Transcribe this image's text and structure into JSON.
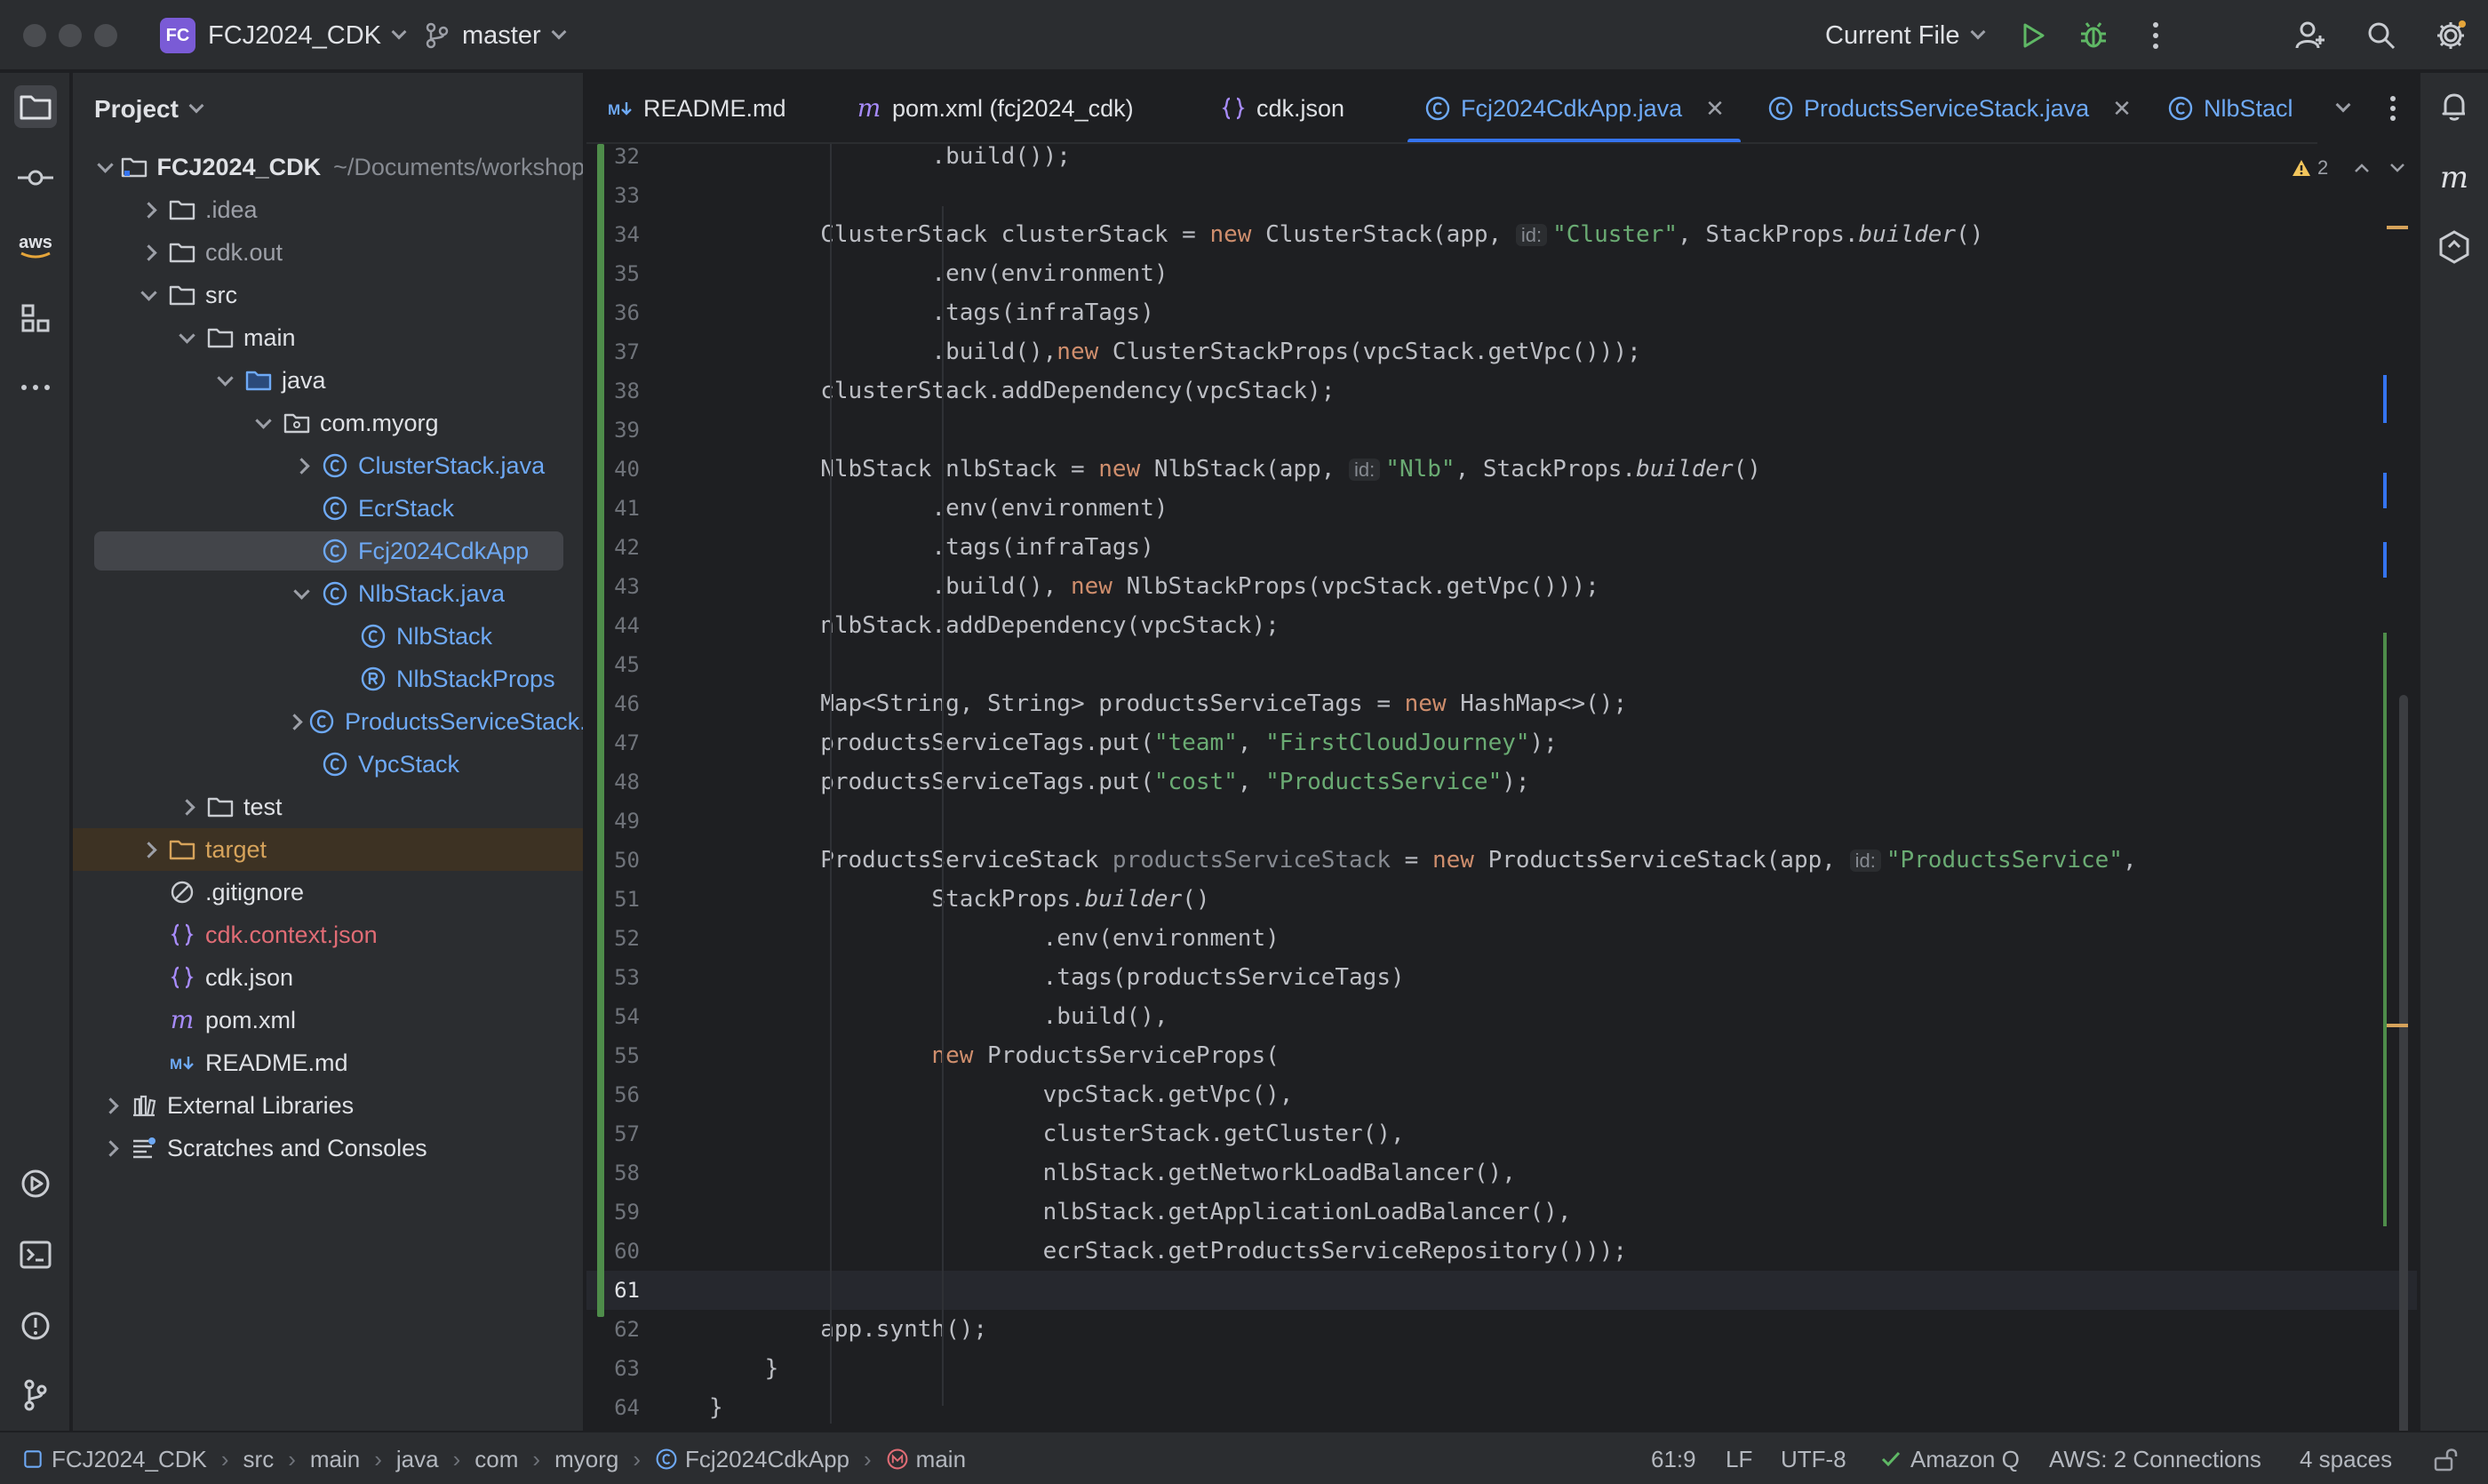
{
  "titlebar": {
    "project_badge": "FC",
    "project_name": "FCJ2024_CDK",
    "branch": "master",
    "run_config": "Current File"
  },
  "project_panel": {
    "title": "Project",
    "tree": [
      {
        "label": "FCJ2024_CDK",
        "hint": "~/Documents/workshop",
        "icon": "module-folder-icon",
        "expand": "down",
        "depth": 0,
        "color": "#dfe1e5",
        "bold": true
      },
      {
        "label": ".idea",
        "icon": "folder-icon",
        "expand": "right",
        "depth": 1,
        "color": "#9da0a8"
      },
      {
        "label": "cdk.out",
        "icon": "folder-icon",
        "expand": "right",
        "depth": 1,
        "color": "#9da0a8"
      },
      {
        "label": "src",
        "icon": "folder-icon",
        "expand": "down",
        "depth": 1,
        "color": "#dfe1e5"
      },
      {
        "label": "main",
        "icon": "folder-icon",
        "expand": "down",
        "depth": 2,
        "color": "#dfe1e5"
      },
      {
        "label": "java",
        "icon": "source-folder-icon",
        "expand": "down",
        "depth": 3,
        "color": "#dfe1e5"
      },
      {
        "label": "com.myorg",
        "icon": "package-icon",
        "expand": "down",
        "depth": 4,
        "color": "#dfe1e5"
      },
      {
        "label": "ClusterStack.java",
        "icon": "java-class-icon",
        "expand": "right",
        "depth": 5,
        "color": "#6ea9f5"
      },
      {
        "label": "EcrStack",
        "icon": "java-class-icon",
        "expand": "none",
        "depth": 5,
        "color": "#6ea9f5"
      },
      {
        "label": "Fcj2024CdkApp",
        "icon": "java-class-icon",
        "expand": "none",
        "depth": 5,
        "color": "#6ea9f5",
        "selected": true
      },
      {
        "label": "NlbStack.java",
        "icon": "java-class-icon",
        "expand": "down",
        "depth": 5,
        "color": "#6ea9f5"
      },
      {
        "label": "NlbStack",
        "icon": "java-class-icon",
        "expand": "none",
        "depth": 6,
        "color": "#6ea9f5"
      },
      {
        "label": "NlbStackProps",
        "icon": "java-record-icon",
        "expand": "none",
        "depth": 6,
        "color": "#6ea9f5"
      },
      {
        "label": "ProductsServiceStack.java",
        "icon": "java-class-icon",
        "expand": "right",
        "depth": 5,
        "color": "#6ea9f5"
      },
      {
        "label": "VpcStack",
        "icon": "java-class-icon",
        "expand": "none",
        "depth": 5,
        "color": "#6ea9f5"
      },
      {
        "label": "test",
        "icon": "folder-icon",
        "expand": "right",
        "depth": 2,
        "color": "#dfe1e5"
      },
      {
        "label": "target",
        "icon": "excluded-folder-icon",
        "expand": "right",
        "depth": 1,
        "color": "#d6a35b",
        "excluded": true
      },
      {
        "label": ".gitignore",
        "icon": "ignore-file-icon",
        "expand": "none",
        "depth": 1,
        "color": "#dfe1e5"
      },
      {
        "label": "cdk.context.json",
        "icon": "json-file-icon",
        "expand": "none",
        "depth": 1,
        "color": "#e06c75"
      },
      {
        "label": "cdk.json",
        "icon": "json-file-icon",
        "expand": "none",
        "depth": 1,
        "color": "#dfe1e5"
      },
      {
        "label": "pom.xml",
        "icon": "maven-icon",
        "expand": "none",
        "depth": 1,
        "color": "#dfe1e5"
      },
      {
        "label": "README.md",
        "icon": "markdown-icon",
        "expand": "none",
        "depth": 1,
        "color": "#dfe1e5"
      },
      {
        "label": "External Libraries",
        "icon": "library-icon",
        "expand": "right",
        "depth": 0,
        "color": "#dfe1e5"
      },
      {
        "label": "Scratches and Consoles",
        "icon": "scratches-icon",
        "expand": "right",
        "depth": 0,
        "color": "#dfe1e5"
      }
    ]
  },
  "tabs": [
    {
      "label": "README.md",
      "icon": "markdown-icon",
      "color": "#dfe1e5",
      "closable": false
    },
    {
      "label": "pom.xml (fcj2024_cdk)",
      "icon": "maven-icon",
      "color": "#dfe1e5",
      "closable": false
    },
    {
      "label": "cdk.json",
      "icon": "json-file-icon",
      "color": "#dfe1e5",
      "closable": false
    },
    {
      "label": "Fcj2024CdkApp.java",
      "icon": "java-class-icon",
      "color": "#6ea9f5",
      "closable": true,
      "active": true
    },
    {
      "label": "ProductsServiceStack.java",
      "icon": "java-class-icon",
      "color": "#6ea9f5",
      "closable": true
    },
    {
      "label": "NlbStacl",
      "icon": "java-class-icon",
      "color": "#6ea9f5",
      "closable": false
    }
  ],
  "editor": {
    "warning_count": "2",
    "first_line": 32,
    "caret_line": 61,
    "lines": [
      [
        [
          "        .build());",
          ""
        ]
      ],
      [],
      [
        [
          "ClusterStack clusterStack = ",
          ""
        ],
        [
          "new",
          "k"
        ],
        [
          " ClusterStack(app, ",
          ""
        ],
        [
          "id:",
          "hint"
        ],
        [
          "\"Cluster\"",
          "s"
        ],
        [
          ", StackProps.",
          ""
        ],
        [
          "builder",
          "i"
        ],
        [
          "()",
          ""
        ]
      ],
      [
        [
          "        .env(environment)",
          ""
        ]
      ],
      [
        [
          "        .tags(infraTags)",
          ""
        ]
      ],
      [
        [
          "        .build(),",
          ""
        ],
        [
          "new",
          "k"
        ],
        [
          " ClusterStackProps(vpcStack.getVpc()));",
          ""
        ]
      ],
      [
        [
          "clusterStack.addDependency(vpcStack);",
          ""
        ]
      ],
      [],
      [
        [
          "NlbStack nlbStack = ",
          ""
        ],
        [
          "new",
          "k"
        ],
        [
          " NlbStack(app, ",
          ""
        ],
        [
          "id:",
          "hint"
        ],
        [
          "\"Nlb\"",
          "s"
        ],
        [
          ", StackProps.",
          ""
        ],
        [
          "builder",
          "i"
        ],
        [
          "()",
          ""
        ]
      ],
      [
        [
          "        .env(environment)",
          ""
        ]
      ],
      [
        [
          "        .tags(infraTags)",
          ""
        ]
      ],
      [
        [
          "        .build(), ",
          ""
        ],
        [
          "new",
          "k"
        ],
        [
          " NlbStackProps(vpcStack.getVpc()));",
          ""
        ]
      ],
      [
        [
          "nlbStack.addDependency(vpcStack);",
          ""
        ]
      ],
      [],
      [
        [
          "Map<String, String> productsServiceTags = ",
          ""
        ],
        [
          "new",
          "k"
        ],
        [
          " HashMap<>();",
          ""
        ]
      ],
      [
        [
          "productsServiceTags.put(",
          ""
        ],
        [
          "\"team\"",
          "s"
        ],
        [
          ", ",
          ""
        ],
        [
          "\"FirstCloudJourney\"",
          "s"
        ],
        [
          ");",
          ""
        ]
      ],
      [
        [
          "productsServiceTags.put(",
          ""
        ],
        [
          "\"cost\"",
          "s"
        ],
        [
          ", ",
          ""
        ],
        [
          "\"ProductsService\"",
          "s"
        ],
        [
          ");",
          ""
        ]
      ],
      [],
      [
        [
          "ProductsServiceStack ",
          ""
        ],
        [
          "productsServiceStack",
          "dim"
        ],
        [
          " = ",
          ""
        ],
        [
          "new",
          "k"
        ],
        [
          " ProductsServiceStack(app, ",
          ""
        ],
        [
          "id:",
          "hint"
        ],
        [
          "\"ProductsService\"",
          "s"
        ],
        [
          ",",
          ""
        ]
      ],
      [
        [
          "        StackProps.",
          ""
        ],
        [
          "builder",
          "i"
        ],
        [
          "()",
          ""
        ]
      ],
      [
        [
          "                .env(environment)",
          ""
        ]
      ],
      [
        [
          "                .tags(productsServiceTags)",
          ""
        ]
      ],
      [
        [
          "                .build(),",
          ""
        ]
      ],
      [
        [
          "        ",
          ""
        ],
        [
          "new",
          "k"
        ],
        [
          " ProductsServiceProps(",
          ""
        ]
      ],
      [
        [
          "                vpcStack.getVpc(),",
          ""
        ]
      ],
      [
        [
          "                clusterStack.getCluster(),",
          ""
        ]
      ],
      [
        [
          "                nlbStack.getNetworkLoadBalancer(),",
          ""
        ]
      ],
      [
        [
          "                nlbStack.getApplicationLoadBalancer(),",
          ""
        ]
      ],
      [
        [
          "                ecrStack.getProductsServiceRepository()));",
          ""
        ]
      ],
      [],
      [
        [
          "app.synth();",
          ""
        ]
      ],
      [
        [
          "}",
          "b1"
        ]
      ],
      [
        [
          "}",
          "b0"
        ]
      ]
    ]
  },
  "statusbar": {
    "breadcrumbs": [
      {
        "label": "FCJ2024_CDK",
        "icon": "module-icon"
      },
      {
        "label": "src",
        "icon": ""
      },
      {
        "label": "main",
        "icon": ""
      },
      {
        "label": "java",
        "icon": ""
      },
      {
        "label": "com",
        "icon": ""
      },
      {
        "label": "myorg",
        "icon": ""
      },
      {
        "label": "Fcj2024CdkApp",
        "icon": "java-class-icon"
      },
      {
        "label": "main",
        "icon": "method-icon"
      }
    ],
    "position": "61:9",
    "line_ending": "LF",
    "encoding": "UTF-8",
    "amazon_q": "Amazon Q",
    "aws": "AWS: 2 Connections",
    "indent": "4 spaces"
  },
  "colors": {
    "accent": "#3574f0",
    "vcs_added": "#4e8c4a",
    "warning": "#f2c55c"
  }
}
